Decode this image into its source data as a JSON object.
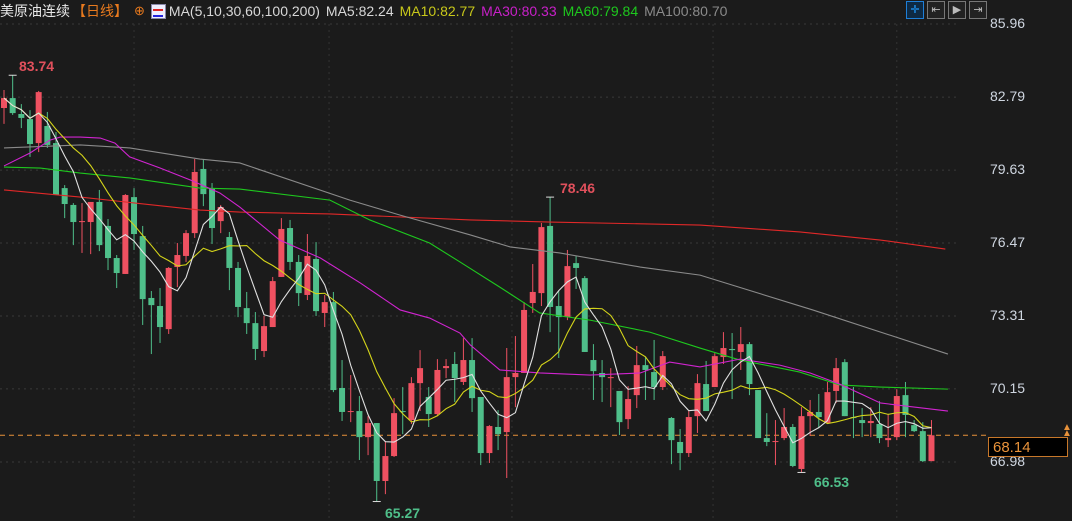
{
  "header": {
    "symbol": "美原油连续",
    "period": "【日线】",
    "ma_label": "MA(5,10,30,60,100,200)",
    "ma5": "MA5:82.24",
    "ma10": "MA10:82.77",
    "ma30": "MA30:80.33",
    "ma60": "MA60:79.84",
    "ma100": "MA100:80.70"
  },
  "toolbar": {
    "icons": [
      "crosshair-icon",
      "range-start-icon",
      "play-icon",
      "exit-icon"
    ]
  },
  "colors": {
    "up": "#ef5161",
    "down": "#4fbf8a",
    "ma5": "#e0e0e0",
    "ma10": "#d4d41a",
    "ma30": "#d024d0",
    "ma60": "#1ec81e",
    "ma100": "#8a8a8a",
    "ma200": "#e02828",
    "last": "#e8923a",
    "background": "#1b1b1b"
  },
  "chart_data": {
    "type": "candlestick",
    "y_axis_ticks": [
      "85.96",
      "82.79",
      "79.63",
      "76.47",
      "73.31",
      "70.15",
      "66.98"
    ],
    "ylim": [
      65.0,
      85.96
    ],
    "grid": true,
    "last_price": "68.14",
    "annotations": {
      "high1": "83.74",
      "high2": "78.46",
      "low1": "65.27",
      "low2": "66.53"
    },
    "ohlc": [
      [
        82.32,
        83.1,
        81.63,
        82.75
      ],
      [
        82.75,
        83.74,
        82.02,
        82.1
      ],
      [
        82.06,
        82.49,
        81.45,
        81.89
      ],
      [
        81.84,
        82.23,
        80.2,
        80.76
      ],
      [
        80.8,
        83.06,
        80.41,
        83.01
      ],
      [
        81.54,
        82.15,
        80.59,
        80.72
      ],
      [
        80.8,
        81.28,
        78.55,
        78.55
      ],
      [
        78.85,
        78.98,
        77.55,
        78.16
      ],
      [
        78.12,
        78.2,
        76.38,
        77.38
      ],
      [
        77.38,
        78.2,
        76.04,
        77.42
      ],
      [
        77.38,
        78.2,
        75.99,
        78.25
      ],
      [
        78.25,
        78.77,
        76.12,
        76.38
      ],
      [
        77.21,
        77.51,
        75.3,
        75.82
      ],
      [
        75.82,
        75.95,
        74.52,
        75.17
      ],
      [
        75.13,
        78.59,
        75.13,
        78.55
      ],
      [
        78.46,
        78.85,
        76.17,
        76.86
      ],
      [
        76.77,
        77.21,
        72.92,
        74.04
      ],
      [
        74.09,
        74.39,
        71.66,
        73.78
      ],
      [
        73.74,
        74.52,
        72.14,
        72.83
      ],
      [
        72.74,
        75.43,
        72.53,
        75.39
      ],
      [
        75.43,
        76.47,
        74.56,
        75.95
      ],
      [
        75.91,
        77.03,
        75.65,
        76.9
      ],
      [
        76.9,
        80.11,
        76.69,
        79.55
      ],
      [
        79.68,
        80.11,
        78.07,
        78.59
      ],
      [
        78.85,
        79.07,
        76.43,
        77.12
      ],
      [
        77.42,
        78.12,
        76.9,
        78.03
      ],
      [
        76.73,
        76.95,
        74.43,
        75.39
      ],
      [
        75.39,
        75.65,
        73.26,
        73.7
      ],
      [
        73.65,
        74.35,
        72.53,
        73.0
      ],
      [
        73.0,
        73.48,
        71.4,
        71.88
      ],
      [
        71.79,
        73.31,
        71.53,
        72.87
      ],
      [
        72.83,
        75.0,
        72.83,
        74.82
      ],
      [
        75.0,
        77.55,
        75.0,
        77.08
      ],
      [
        77.12,
        77.47,
        75.3,
        75.65
      ],
      [
        75.65,
        75.95,
        73.74,
        74.3
      ],
      [
        74.22,
        76.86,
        74.0,
        75.91
      ],
      [
        75.78,
        76.51,
        73.31,
        73.52
      ],
      [
        73.44,
        74.22,
        72.83,
        73.91
      ],
      [
        73.91,
        74.35,
        70.01,
        70.1
      ],
      [
        70.19,
        71.4,
        68.76,
        69.15
      ],
      [
        69.15,
        70.75,
        68.71,
        69.19
      ],
      [
        69.19,
        69.84,
        67.07,
        68.06
      ],
      [
        68.06,
        68.97,
        67.28,
        68.67
      ],
      [
        68.67,
        68.67,
        65.27,
        66.16
      ],
      [
        66.16,
        67.89,
        65.59,
        67.24
      ],
      [
        67.24,
        69.75,
        67.2,
        69.1
      ],
      [
        69.19,
        70.23,
        68.19,
        69.15
      ],
      [
        68.8,
        70.66,
        68.63,
        70.4
      ],
      [
        70.4,
        71.83,
        69.19,
        71.05
      ],
      [
        69.8,
        70.23,
        68.5,
        69.06
      ],
      [
        69.06,
        71.44,
        68.97,
        70.97
      ],
      [
        71.05,
        71.44,
        70.62,
        71.14
      ],
      [
        71.23,
        71.75,
        69.58,
        70.62
      ],
      [
        70.45,
        72.35,
        70.32,
        71.4
      ],
      [
        71.4,
        72.35,
        69.15,
        69.75
      ],
      [
        69.8,
        69.8,
        66.85,
        67.37
      ],
      [
        67.37,
        68.58,
        66.94,
        68.54
      ],
      [
        68.5,
        69.23,
        67.5,
        68.19
      ],
      [
        68.28,
        71.92,
        66.29,
        70.66
      ],
      [
        70.66,
        72.44,
        69.36,
        70.84
      ],
      [
        70.84,
        73.91,
        70.84,
        73.57
      ],
      [
        73.87,
        75.56,
        73.44,
        74.35
      ],
      [
        74.3,
        77.34,
        73.74,
        77.16
      ],
      [
        77.21,
        78.46,
        72.61,
        73.7
      ],
      [
        73.74,
        74.39,
        71.49,
        73.26
      ],
      [
        73.26,
        76.17,
        73.13,
        75.47
      ],
      [
        75.6,
        75.91,
        74.48,
        75.39
      ],
      [
        74.95,
        75.04,
        71.75,
        71.75
      ],
      [
        71.4,
        72.09,
        69.67,
        70.92
      ],
      [
        70.84,
        71.4,
        69.58,
        70.66
      ],
      [
        70.62,
        71.05,
        69.36,
        70.66
      ],
      [
        70.06,
        70.06,
        68.15,
        68.71
      ],
      [
        68.84,
        70.27,
        68.41,
        69.71
      ],
      [
        69.88,
        72.01,
        69.32,
        71.18
      ],
      [
        71.18,
        71.53,
        69.67,
        70.97
      ],
      [
        70.88,
        72.27,
        69.67,
        70.23
      ],
      [
        70.23,
        71.79,
        70.1,
        71.57
      ],
      [
        68.89,
        68.93,
        66.89,
        67.93
      ],
      [
        67.85,
        68.41,
        66.63,
        67.37
      ],
      [
        67.37,
        69.19,
        67.2,
        68.93
      ],
      [
        68.97,
        70.79,
        68.24,
        70.4
      ],
      [
        70.36,
        71.36,
        69.19,
        69.19
      ],
      [
        70.23,
        71.7,
        70.23,
        71.57
      ],
      [
        71.53,
        72.61,
        71.23,
        71.92
      ],
      [
        71.88,
        72.57,
        69.71,
        71.83
      ],
      [
        71.75,
        72.83,
        70.97,
        72.09
      ],
      [
        72.09,
        72.18,
        69.88,
        70.36
      ],
      [
        70.1,
        70.1,
        68.02,
        68.02
      ],
      [
        68.02,
        69.1,
        67.67,
        67.85
      ],
      [
        67.85,
        68.8,
        66.85,
        67.89
      ],
      [
        68.02,
        69.32,
        67.93,
        68.5
      ],
      [
        68.5,
        68.63,
        66.76,
        66.81
      ],
      [
        66.68,
        69.36,
        66.53,
        68.97
      ],
      [
        68.97,
        69.67,
        68.11,
        69.15
      ],
      [
        69.15,
        69.93,
        68.45,
        68.93
      ],
      [
        68.67,
        70.45,
        68.63,
        70.01
      ],
      [
        70.06,
        71.49,
        69.54,
        71.05
      ],
      [
        71.31,
        71.44,
        68.97,
        68.97
      ],
      [
        68.93,
        70.23,
        68.02,
        68.89
      ],
      [
        68.8,
        69.32,
        68.06,
        68.67
      ],
      [
        68.67,
        69.36,
        68.06,
        68.76
      ],
      [
        68.63,
        69.62,
        67.8,
        68.02
      ],
      [
        67.93,
        69.06,
        67.63,
        68.02
      ],
      [
        68.06,
        70.14,
        67.93,
        69.84
      ],
      [
        69.88,
        70.45,
        68.06,
        69.02
      ],
      [
        68.58,
        68.8,
        68.28,
        68.32
      ],
      [
        68.32,
        68.71,
        66.98,
        67.02
      ],
      [
        67.02,
        68.8,
        67.02,
        68.14
      ]
    ],
    "ma_series": {
      "ma30": [
        [
          0,
          79.81
        ],
        [
          3,
          80.37
        ],
        [
          5.3,
          80.93
        ],
        [
          6.5,
          81.06
        ],
        [
          8.8,
          81.06
        ],
        [
          11.1,
          81.02
        ],
        [
          12.8,
          80.8
        ],
        [
          14.5,
          80.2
        ],
        [
          18,
          79.72
        ],
        [
          21.5,
          79.2
        ],
        [
          24.9,
          78.64
        ],
        [
          27.2,
          78.03
        ],
        [
          31.8,
          76.6
        ],
        [
          36.5,
          75.82
        ],
        [
          41.1,
          74.74
        ],
        [
          45.7,
          73.57
        ],
        [
          49.1,
          73.22
        ],
        [
          52.6,
          72.57
        ],
        [
          53.8,
          72.05
        ],
        [
          57.2,
          70.97
        ],
        [
          61.8,
          70.84
        ],
        [
          67.6,
          70.75
        ],
        [
          73.4,
          70.84
        ],
        [
          76.8,
          71.31
        ],
        [
          80.3,
          71.1
        ],
        [
          84.9,
          71.44
        ],
        [
          89.5,
          71.18
        ],
        [
          93,
          70.84
        ],
        [
          96.4,
          70.36
        ],
        [
          101.1,
          69.54
        ],
        [
          108.9,
          69.19
        ]
      ],
      "ma60": [
        [
          0,
          79.76
        ],
        [
          4.2,
          79.72
        ],
        [
          8.8,
          79.5
        ],
        [
          14.5,
          79.29
        ],
        [
          22.6,
          78.85
        ],
        [
          27.2,
          78.81
        ],
        [
          37.6,
          78.33
        ],
        [
          42.2,
          77.47
        ],
        [
          49.1,
          76.47
        ],
        [
          52.6,
          75.65
        ],
        [
          57.2,
          74.56
        ],
        [
          61.8,
          73.44
        ],
        [
          67.6,
          73.13
        ],
        [
          74.5,
          72.61
        ],
        [
          80.3,
          71.92
        ],
        [
          84.9,
          71.4
        ],
        [
          91.8,
          70.88
        ],
        [
          96.4,
          70.32
        ],
        [
          101.1,
          70.23
        ],
        [
          108.9,
          70.14
        ]
      ],
      "ma100": [
        [
          0,
          80.59
        ],
        [
          8.8,
          80.72
        ],
        [
          14.5,
          80.59
        ],
        [
          22.6,
          80.11
        ],
        [
          27.2,
          79.94
        ],
        [
          39.9,
          78.33
        ],
        [
          45.7,
          77.68
        ],
        [
          53.8,
          76.82
        ],
        [
          58.4,
          76.3
        ],
        [
          64.1,
          76.04
        ],
        [
          73.4,
          75.43
        ],
        [
          80.3,
          75.08
        ],
        [
          93.3,
          73.57
        ],
        [
          108.9,
          71.66
        ]
      ],
      "ma200": [
        [
          0,
          78.77
        ],
        [
          8.8,
          78.46
        ],
        [
          22.6,
          77.9
        ],
        [
          27.2,
          77.81
        ],
        [
          37.6,
          77.73
        ],
        [
          53.8,
          77.47
        ],
        [
          63,
          77.38
        ],
        [
          80.3,
          77.25
        ],
        [
          91.8,
          76.95
        ],
        [
          101.1,
          76.6
        ],
        [
          108.6,
          76.21
        ]
      ]
    }
  }
}
